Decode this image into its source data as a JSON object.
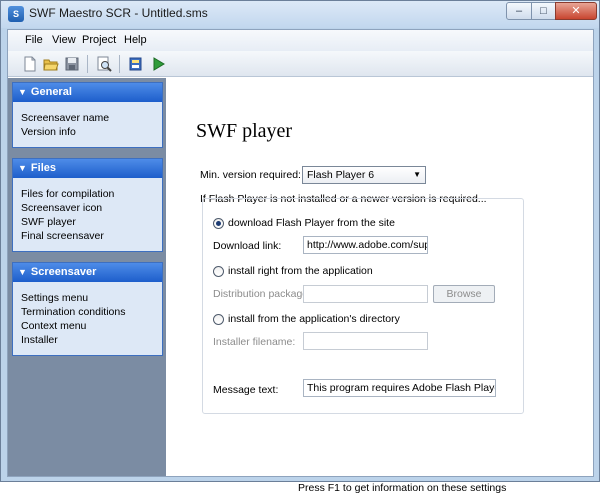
{
  "window": {
    "title": "SWF Maestro SCR - Untitled.sms",
    "icon": "app-icon"
  },
  "caption_buttons": {
    "min": "–",
    "max": "□",
    "close": "✕"
  },
  "menu": {
    "file": "File",
    "view": "View",
    "project": "Project",
    "help": "Help"
  },
  "toolbar": {
    "icons": [
      "new-file-icon",
      "open-folder-icon",
      "save-icon",
      "preview-icon",
      "build-icon",
      "run-icon"
    ]
  },
  "sidebar": {
    "groups": [
      {
        "title": "General",
        "items": [
          "Screensaver name",
          "Version info"
        ]
      },
      {
        "title": "Files",
        "items": [
          "Files for compilation",
          "Screensaver icon",
          "SWF player",
          "Final screensaver"
        ]
      },
      {
        "title": "Screensaver",
        "items": [
          "Settings menu",
          "Termination conditions",
          "Context menu",
          "Installer"
        ]
      }
    ]
  },
  "main": {
    "title": "SWF player",
    "min_version_label": "Min. version required:",
    "min_version_value": "Flash Player 6",
    "not_installed_label": "If Flash Player is not installed or a newer version is required...",
    "options": {
      "download": "download Flash Player from the site",
      "download_link_label": "Download link:",
      "download_link_value": "http://www.adobe.com/supp",
      "install_right": "install right from the application",
      "distribution_label": "Distribution package:",
      "browse": "Browse",
      "install_dir": "install from the application's directory",
      "installer_label": "Installer filename:"
    },
    "message_label": "Message text:",
    "message_value": "This program requires Adobe Flash Player Acti",
    "selected_option": "download"
  },
  "status": "Press F1 to get information on these settings",
  "colors": {
    "header_blue": "#1d5ecb",
    "panel_bg": "#7b8ca3",
    "item_bg": "#dde8f6"
  }
}
